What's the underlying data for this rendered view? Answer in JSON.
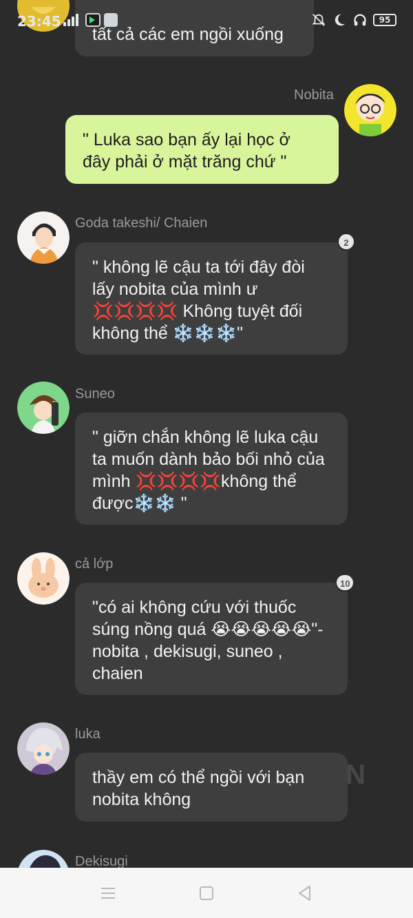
{
  "status_bar": {
    "time": "23:45",
    "battery": "95",
    "icons": [
      "signal-icon",
      "app-icon",
      "app-icon",
      "mute-icon",
      "moon-icon",
      "headphones-icon",
      "battery-icon"
    ]
  },
  "messages": [
    {
      "name": "",
      "text": "tất cả các em ngồi xuống",
      "avatar": "avatar-partial"
    },
    {
      "name": "Nobita",
      "text": "\" Luka sao bạn ấy lại học ở đây phải ở mặt trăng chứ \"",
      "mine": true
    },
    {
      "name": "Goda  takeshi/ Chaien",
      "text": "\" không lẽ cậu ta tới đây đòi lấy nobita của mình ư 💢💢💢💢 Không tuyệt đối không thể ❄️❄️❄️\"",
      "badge": "2"
    },
    {
      "name": "Suneo",
      "text": "\" giỡn chắn không lẽ luka cậu ta muốn dành bảo bối nhỏ của mình 💢💢💢💢không thể được❄️❄️ \""
    },
    {
      "name": "cả lớp",
      "text": "\"có ai không cứu với thuốc súng nồng quá 😭😭😭😭😭\"- nobita , dekisugi, suneo , chaien",
      "badge": "10"
    },
    {
      "name": "luka",
      "text": "thầy em có thể ngồi với bạn nobita không"
    },
    {
      "name": "Dekisugi",
      "text": ""
    }
  ],
  "watermark": "ON",
  "colors": {
    "background": "#2b2b2b",
    "bubble": "#3e3e3e",
    "my_bubble": "#d9f59b",
    "nav_bar": "#f6f6f6"
  }
}
